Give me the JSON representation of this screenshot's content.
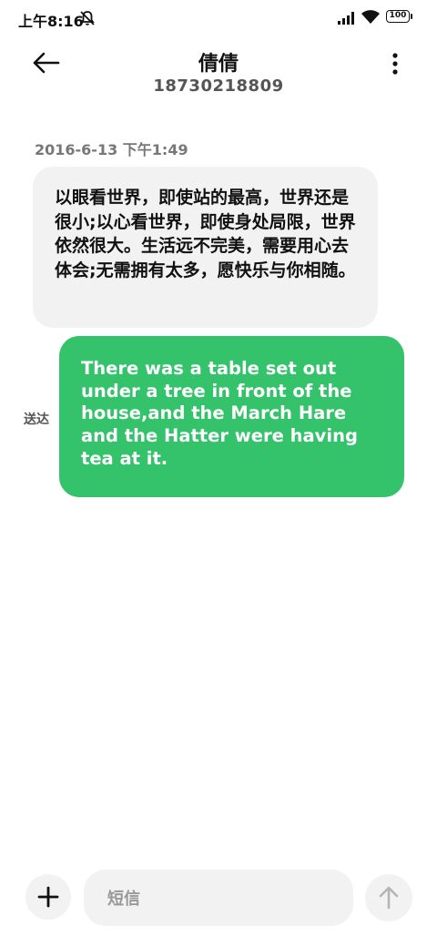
{
  "status_bar": {
    "time": "上午8:16",
    "battery": "100",
    "icons": [
      "mute-icon",
      "signal-icon",
      "wifi-icon",
      "battery-icon"
    ]
  },
  "header": {
    "contact_name": "倩倩",
    "contact_number": "18730218809",
    "icons": [
      "back-arrow-icon",
      "more-vertical-icon"
    ]
  },
  "conversation": {
    "timestamp": "2016-6-13  下午1:49",
    "incoming_message": "以眼看世界，即使站的最高，世界还是很小;以心看世界，即使身处局限，世界依然很大。生活远不完美，需要用心去体会;无需拥有太多，愿快乐与你相随。",
    "outgoing_status": "送达",
    "outgoing_message": "There was a table set out under a tree in front of the house,and the March Hare and the Hatter were having tea at it.",
    "colors": {
      "incoming_bubble": "#f2f2f2",
      "outgoing_bubble": "#34c26b"
    }
  },
  "composer": {
    "placeholder": "短信",
    "icons": [
      "plus-icon",
      "send-arrow-up-icon"
    ]
  }
}
